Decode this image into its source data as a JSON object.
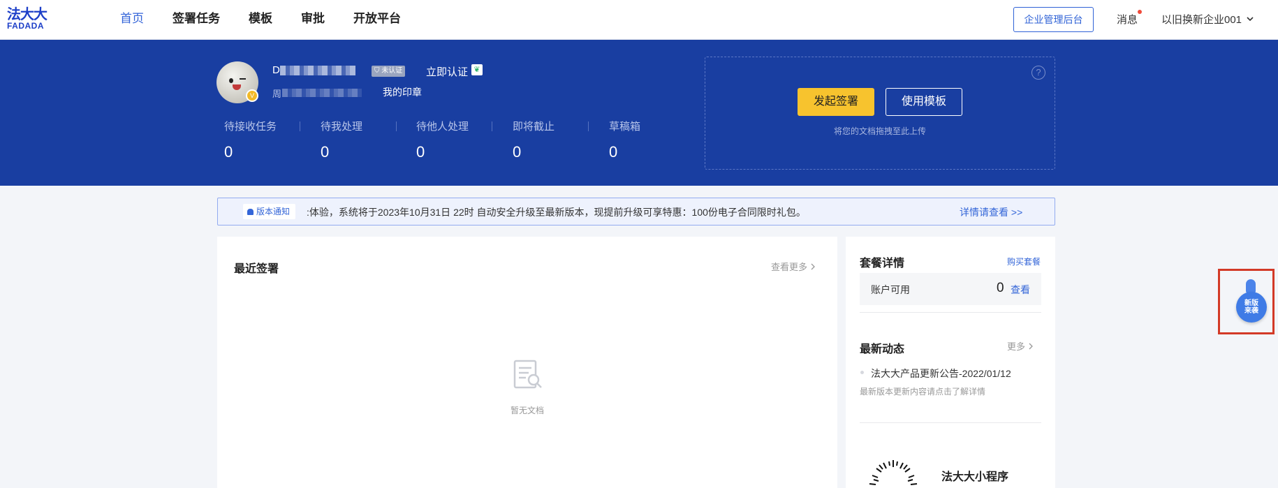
{
  "logo": {
    "cn": "法大大",
    "en": "FADADA"
  },
  "nav": [
    "首页",
    "签署任务",
    "模板",
    "审批",
    "开放平台"
  ],
  "header": {
    "admin_button": "企业管理后台",
    "messages": "消息",
    "company": "以旧换新企业001"
  },
  "profile": {
    "name_prefix": "D",
    "unverified_tag": "未认证",
    "verify_now": "立即认证",
    "sub_prefix": "周",
    "my_seal": "我的印章"
  },
  "stats": [
    {
      "label": "待接收任务",
      "value": "0"
    },
    {
      "label": "待我处理",
      "value": "0"
    },
    {
      "label": "待他人处理",
      "value": "0"
    },
    {
      "label": "即将截止",
      "value": "0"
    },
    {
      "label": "草稿箱",
      "value": "0"
    }
  ],
  "actions": {
    "start_sign": "发起签署",
    "use_template": "使用模板",
    "drop_hint": "将您的文档拖拽至此上传"
  },
  "notice": {
    "tag": "版本通知",
    "text": ":体验，系统将于2023年10月31日 22时 自动安全升级至最新版本，现提前升级可享特惠：100份电子合同限时礼包。",
    "more": "详情请查看 >>"
  },
  "recent": {
    "title": "最近签署",
    "more": "查看更多",
    "empty": "暂无文档"
  },
  "package": {
    "title": "套餐详情",
    "buy": "购买套餐",
    "available_label": "账户可用",
    "available_value": "0",
    "view": "查看"
  },
  "news": {
    "title": "最新动态",
    "more": "更多",
    "item": "法大大产品更新公告-2022/01/12",
    "sub": "最新版本更新内容请点击了解详情"
  },
  "mini_program": {
    "title": "法大大小程序"
  },
  "float_button": {
    "line1": "新版",
    "line2": "来袭"
  },
  "colors": {
    "primary": "#193ea1",
    "accent": "#f7c32e",
    "link": "#3466d8"
  }
}
